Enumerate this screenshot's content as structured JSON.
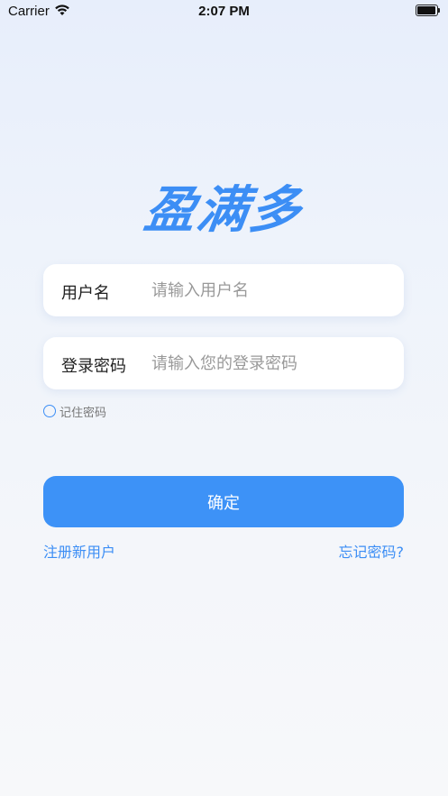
{
  "status_bar": {
    "carrier": "Carrier",
    "time": "2:07 PM"
  },
  "logo": {
    "text": "盈满多"
  },
  "form": {
    "username": {
      "label": "用户名",
      "placeholder": "请输入用户名",
      "value": ""
    },
    "password": {
      "label": "登录密码",
      "placeholder": "请输入您的登录密码",
      "value": ""
    },
    "remember_password": {
      "label": "记住密码",
      "checked": false
    },
    "confirm_label": "确定"
  },
  "links": {
    "register": "注册新用户",
    "forgot_password": "忘记密码?"
  },
  "colors": {
    "accent": "#3d92f7",
    "background_top": "#e7eefb",
    "background_bottom": "#f7f8fa"
  }
}
